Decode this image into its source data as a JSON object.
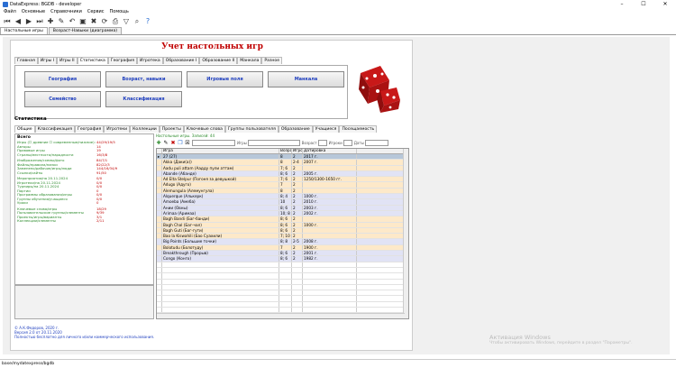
{
  "window": {
    "title": "DataExpress: BGDB - developer",
    "minimize": "–",
    "maximize": "☐",
    "close": "✕"
  },
  "menu": [
    "Файл",
    "Основные",
    "Справочники",
    "Сервис",
    "Помощь"
  ],
  "toolbar_icons": [
    "first-icon",
    "prev-icon",
    "next-icon",
    "last-icon",
    "add-icon",
    "edit-icon",
    "undo-icon",
    "save-icon",
    "delete-icon",
    "refresh-icon",
    "print-icon",
    "filter-icon",
    "find-icon",
    "help-icon"
  ],
  "doc_tabs": [
    "Настольные игры",
    "Возраст-Навыки (диаграмма)"
  ],
  "app_title": "Учет настольных игр",
  "main_tabs": [
    "Главная",
    "Игры I",
    "Игры II",
    "Статистика",
    "География",
    "Игротека",
    "Образование I",
    "Образование II",
    "Манкала",
    "Разное"
  ],
  "buttons": [
    "География",
    "Возраст, навыки",
    "Игровые поля",
    "Манкала",
    "Семейство",
    "Классификация"
  ],
  "stats_title": "Статистика",
  "stat_tabs": [
    "Общие",
    "Классификация",
    "География",
    "Игротеки",
    "Коллекции",
    "Проекты",
    "Ключевые слова",
    "Группы пользователя",
    "Образование",
    "Учащиеся",
    "Посещаемость"
  ],
  "stats": {
    "section": "Всего",
    "rows": [
      {
        "l": "Игры (☐ древние ☐ современные/нижние):",
        "v": "44/29/19/5"
      },
      {
        "l": "Авторы",
        "v": "14"
      },
      {
        "l": "Правовые игры",
        "v": "19"
      },
      {
        "l": "Страны/местности/народности",
        "v": "16/3/8"
      },
      {
        "l": "",
        "v": ""
      },
      {
        "l": "Изображения/схемы/фото",
        "v": "84/7/1"
      },
      {
        "l": "Файлы/правила/папки",
        "v": "82/22/3"
      },
      {
        "l": "Заменено/рабочие/игры/люди",
        "v": "144/16/34/9"
      },
      {
        "l": "Ссылки/сайты",
        "v": "91/50"
      },
      {
        "l": "",
        "v": ""
      },
      {
        "l": "Мероприятия/на 20.11.2024",
        "v": "0/0"
      },
      {
        "l": "Игротеки/на 20.11.2024",
        "v": "0/0"
      },
      {
        "l": "Турниры/на 20.11.2024",
        "v": "0/0"
      },
      {
        "l": "Партии",
        "v": "0"
      },
      {
        "l": "Программы образования/игры",
        "v": "0/0"
      },
      {
        "l": "Группы обучения/учащиеся",
        "v": "0/0"
      },
      {
        "l": "Уроки",
        "v": "0"
      },
      {
        "l": "",
        "v": ""
      },
      {
        "l": "Ключевые слова/игры",
        "v": "18/29"
      },
      {
        "l": "Пользовательские группы/элементы",
        "v": "9/39"
      },
      {
        "l": "Проекты/игры/варианты",
        "v": "3/1"
      },
      {
        "l": "Коллекции/элементы",
        "v": "2/11"
      }
    ]
  },
  "grid_section": "Настольные игры. Записей: 44",
  "filter": {
    "age_label": "Возраст",
    "players_label": "Игроки",
    "date_label": "Даты",
    "game_label": "Игры"
  },
  "grid_headers": [
    "Игра",
    "Возрас",
    "Игроки",
    "Датировка"
  ],
  "grid_rows": [
    {
      "name": "27 (27)",
      "age": "8",
      "players": "2",
      "date": "2017 г.",
      "kind": "sel"
    },
    {
      "name": "Akka (Даки(а))",
      "age": "8",
      "players": "2-4",
      "date": "2007 г.",
      "kind": "alt"
    },
    {
      "name": "Aadu puli attam (Аадду пули аттам)",
      "age": "7; 6",
      "players": "2",
      "date": "",
      "kind": "alt"
    },
    {
      "name": "Abande (Абанде)",
      "age": "8; 6",
      "players": "2",
      "date": "2005 г.",
      "kind": "alt2"
    },
    {
      "name": "Ad Elta Stelpur (Погоня за девушкой)",
      "age": "7; 6",
      "players": "2",
      "date": "1250/1300-1650 гг.",
      "kind": "alt"
    },
    {
      "name": "Adugo (Адуго)",
      "age": "7",
      "players": "2",
      "date": "",
      "kind": "alt"
    },
    {
      "name": "Alemungula (Алемунгула)",
      "age": "8",
      "players": "2",
      "date": "",
      "kind": "alt"
    },
    {
      "name": "Alquerque (Алькерк)",
      "age": "8; 4",
      "players": "2",
      "date": "1000 г.",
      "kind": "alt2"
    },
    {
      "name": "Amoeba (Амеба)",
      "age": "10",
      "players": "2",
      "date": "2010 г.",
      "kind": "alt2"
    },
    {
      "name": "Ании (Овны)",
      "age": "8; 6",
      "players": "2",
      "date": "2003 г.",
      "kind": "alt2"
    },
    {
      "name": "Arimaa (Аримаа)",
      "age": "10; 8",
      "players": "2",
      "date": "2002 г.",
      "kind": "alt2"
    },
    {
      "name": "Bagh Bandi (Баг-банди)",
      "age": "8; 6",
      "players": "2",
      "date": "",
      "kind": "alt"
    },
    {
      "name": "Bagh Chal (Баг-чал)",
      "age": "8; 6",
      "players": "2",
      "date": "1000 г.",
      "kind": "alt"
    },
    {
      "name": "Bagh Guti (Баг-гути)",
      "age": "8; 6",
      "players": "2",
      "date": "",
      "kind": "alt"
    },
    {
      "name": "Bao la Kiswahili (Бао Суахили)",
      "age": "7; 10",
      "players": "2",
      "date": "",
      "kind": "alt"
    },
    {
      "name": "Big Points (Большие точки)",
      "age": "8; 8",
      "players": "2-5",
      "date": "2008 г.",
      "kind": "alt2"
    },
    {
      "name": "Bolotudu (Болотуду)",
      "age": "7",
      "players": "2",
      "date": "1900 г.",
      "kind": "alt"
    },
    {
      "name": "Breakthrough (Прорыв)",
      "age": "8; 6",
      "players": "2",
      "date": "2001 г.",
      "kind": "alt2"
    },
    {
      "name": "Congo (Конго)",
      "age": "8; 6",
      "players": "2",
      "date": "1982 г.",
      "kind": "alt2"
    },
    {
      "name": "",
      "age": "",
      "players": "",
      "date": "",
      "kind": ""
    },
    {
      "name": "",
      "age": "",
      "players": "",
      "date": "",
      "kind": ""
    },
    {
      "name": "",
      "age": "",
      "players": "",
      "date": "",
      "kind": ""
    },
    {
      "name": "",
      "age": "",
      "players": "",
      "date": "",
      "kind": ""
    },
    {
      "name": "",
      "age": "",
      "players": "",
      "date": "",
      "kind": ""
    },
    {
      "name": "",
      "age": "",
      "players": "",
      "date": "",
      "kind": ""
    },
    {
      "name": "",
      "age": "",
      "players": "",
      "date": "",
      "kind": ""
    },
    {
      "name": "",
      "age": "",
      "players": "",
      "date": "",
      "kind": ""
    },
    {
      "name": "",
      "age": "",
      "players": "",
      "date": "",
      "kind": ""
    },
    {
      "name": "",
      "age": "",
      "players": "",
      "date": "",
      "kind": ""
    }
  ],
  "footer": [
    "© А.К.Федоров, 2020 г.",
    "Версия 2.0 от 20.11.2020",
    "Полностью бесплатно для личного и/или коммерческого использования."
  ],
  "activation": {
    "title": "Активация Windows",
    "sub": "Чтобы активировать Windows, перейдите в раздел \"Параметры\"."
  },
  "statusbar": "base/mydatexpress/bgdb"
}
